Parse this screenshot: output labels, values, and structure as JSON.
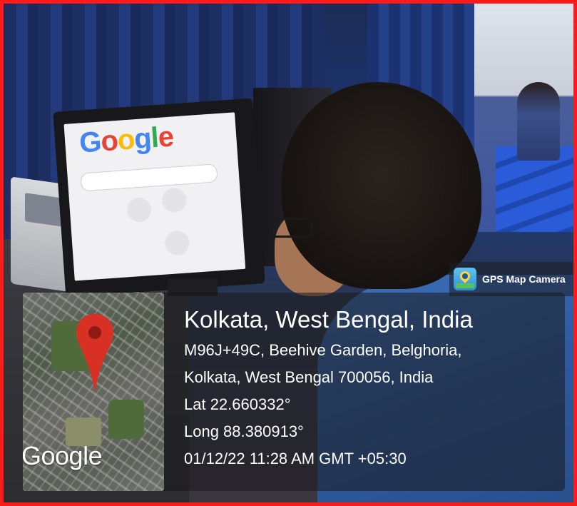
{
  "overlay": {
    "app_label": "GPS Map Camera",
    "map_brand": "Google",
    "place_title": "Kolkata, West Bengal, India",
    "address_line1": "M96J+49C, Beehive Garden, Belghoria,",
    "address_line2": "Kolkata, West Bengal 700056, India",
    "latitude": "Lat 22.660332°",
    "longitude": "Long 88.380913°",
    "datetime": "01/12/22 11:28 AM GMT +05:30"
  },
  "photo": {
    "screen_logo": "Google",
    "border_color": "#ff1a1a",
    "pin_color": "#d93025"
  }
}
